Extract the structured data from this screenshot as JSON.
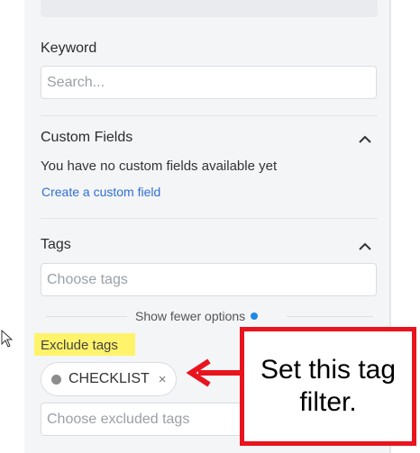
{
  "keyword": {
    "label": "Keyword",
    "placeholder": "Search..."
  },
  "custom_fields": {
    "title": "Custom Fields",
    "empty_text": "You have no custom fields available yet",
    "create_link": "Create a custom field"
  },
  "tags": {
    "label": "Tags",
    "placeholder": "Choose tags"
  },
  "show_fewer": "Show fewer options",
  "exclude_tags": {
    "label": "Exclude tags",
    "chip_label": "CHECKLIST",
    "chip_remove": "×",
    "placeholder": "Choose excluded tags"
  },
  "annotation": {
    "text_line1": "Set this tag",
    "text_line2": "filter."
  },
  "colors": {
    "accent": "#2f6fd6",
    "highlight": "#fff36b",
    "callout_border": "#e8141e",
    "indicator_dot": "#1e88e5"
  }
}
